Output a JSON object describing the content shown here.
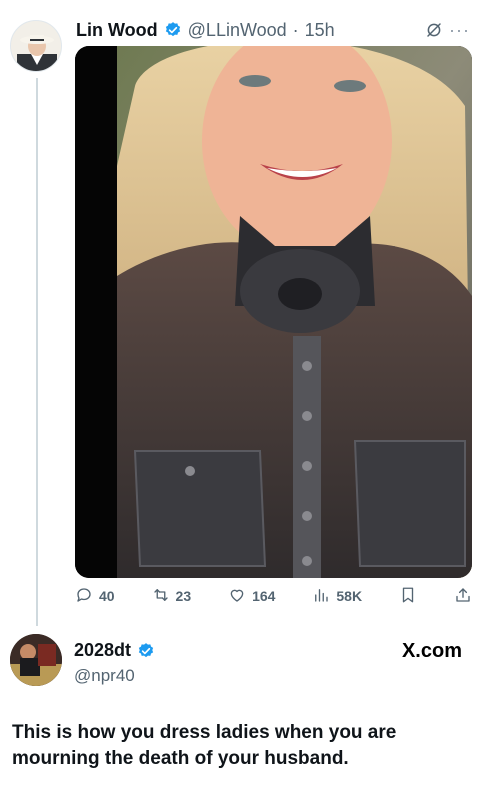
{
  "tweet": {
    "display_name": "Lin Wood",
    "handle": "@LLinWood",
    "separator": "·",
    "time": "15h",
    "more": "···",
    "actions": {
      "replies": "40",
      "reposts": "23",
      "likes": "164",
      "views": "58K"
    }
  },
  "reply": {
    "display_name": "2028dt",
    "handle": "@npr40",
    "watermark": "X.com",
    "text": "This is how you dress ladies when you are mourning the death of your husband."
  },
  "colors": {
    "verified": "#1d9bf0",
    "muted": "#536471",
    "thread_line": "#cfd9de"
  },
  "icons": [
    "verified-badge-icon",
    "grok-icon",
    "more-icon",
    "reply-icon",
    "repost-icon",
    "like-icon",
    "views-icon",
    "bookmark-icon",
    "share-icon"
  ]
}
